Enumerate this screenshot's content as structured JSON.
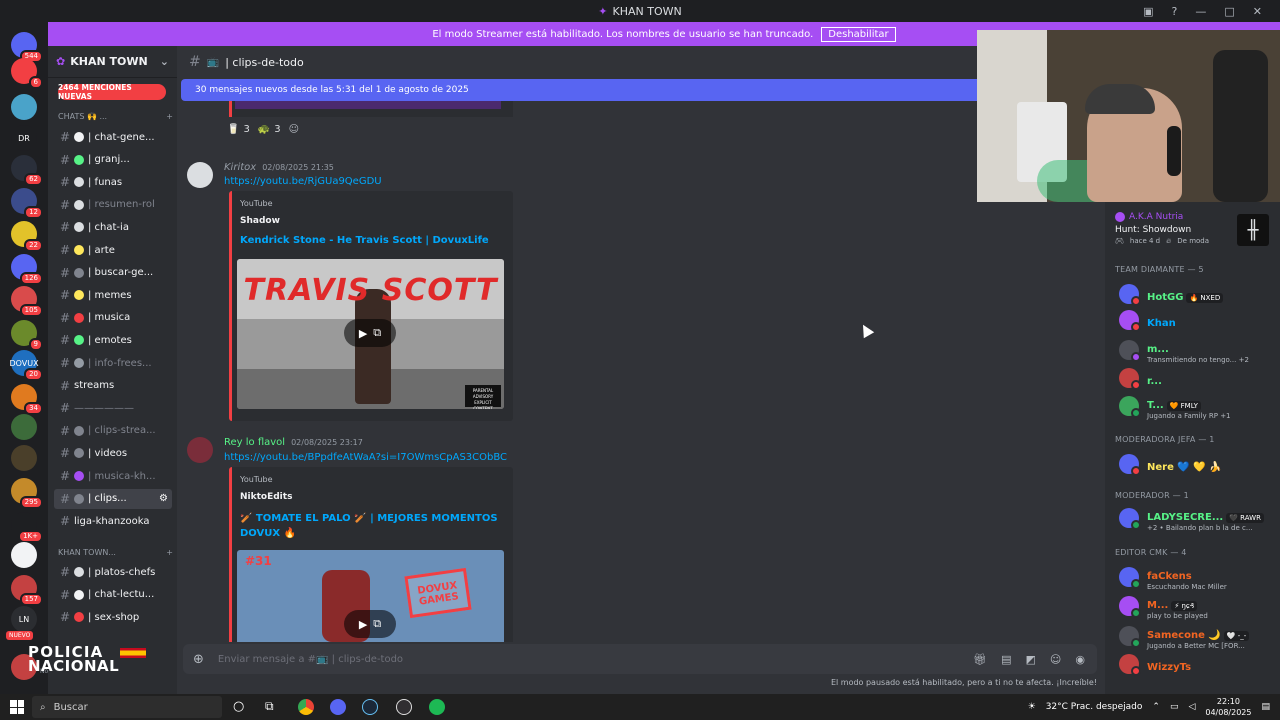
{
  "app": {
    "title": "KHAN TOWN"
  },
  "streamer_banner": {
    "text": "El modo Streamer está habilitado. Los nombres de usuario se han truncado.",
    "button": "Deshabilitar"
  },
  "servers": [
    {
      "label": "",
      "badge": "544",
      "color": "#5865f2"
    },
    {
      "label": "",
      "badge": "6",
      "color": "#f23f43"
    },
    {
      "label": "",
      "badge": "",
      "color": "#4aa3c9"
    },
    {
      "label": "DR",
      "badge": "",
      "color": "#1e1f22"
    },
    {
      "label": "",
      "badge": "62",
      "color": "#2a2f3a"
    },
    {
      "label": "",
      "badge": "12",
      "color": "#3b4c8c"
    },
    {
      "label": "",
      "badge": "22",
      "color": "#e2c22a"
    },
    {
      "label": "",
      "badge": "126",
      "color": "#5865f2"
    },
    {
      "label": "",
      "badge": "105",
      "color": "#d94b4b"
    },
    {
      "label": "",
      "badge": "9",
      "color": "#6b8a2b"
    },
    {
      "label": "DOVUX",
      "badge": "20",
      "color": "#1f6fbf"
    },
    {
      "label": "",
      "badge": "34",
      "color": "#e07a1f"
    },
    {
      "label": "",
      "badge": "",
      "color": "#3c6b3a"
    },
    {
      "label": "",
      "badge": "",
      "color": "#4a3f2a"
    },
    {
      "label": "",
      "badge": "295",
      "color": "#c48a2a"
    },
    {
      "label": "",
      "badge": "1K+",
      "color": "#1e1f22"
    },
    {
      "label": "",
      "badge": "",
      "color": "#f2f3f5"
    },
    {
      "label": "",
      "badge": "157",
      "color": "#c44141"
    },
    {
      "label": "LN",
      "badge": "",
      "color": "#2b2d31"
    }
  ],
  "server_new_label": "NUEVO",
  "guild": {
    "name": "KHAN TOWN",
    "mentions_pill": "2464 MENCIONES NUEVAS",
    "category_chats": "CHATS 🙌 ...",
    "category_khantown": "KHAN TOWN...",
    "channels": [
      {
        "name": "| chat-gene...",
        "muted": false,
        "emoji_color": "#f2f3f5"
      },
      {
        "name": "| granj...",
        "muted": false,
        "emoji_color": "#57f287"
      },
      {
        "name": "| funas",
        "muted": false,
        "emoji_color": "#dbdee1"
      },
      {
        "name": "| resumen-rol",
        "muted": true,
        "emoji_color": "#dbdee1"
      },
      {
        "name": "| chat-ia",
        "muted": false,
        "emoji_color": "#dbdee1"
      },
      {
        "name": "| arte",
        "muted": false,
        "emoji_color": "#fee75c"
      },
      {
        "name": "| buscar-ge...",
        "muted": false,
        "emoji_color": "#80848e"
      },
      {
        "name": "| memes",
        "muted": false,
        "emoji_color": "#fee75c"
      },
      {
        "name": "| musica",
        "muted": false,
        "emoji_color": "#f23f43"
      },
      {
        "name": "| emotes",
        "muted": false,
        "emoji_color": "#57f287"
      },
      {
        "name": "| info-frees...",
        "muted": true,
        "emoji_color": "#949ba4"
      },
      {
        "name": "streams",
        "muted": false,
        "emoji_color": ""
      },
      {
        "name": "——————",
        "muted": true,
        "emoji_color": ""
      },
      {
        "name": "| clips-strea...",
        "muted": true,
        "emoji_color": "#80848e"
      },
      {
        "name": "| videos",
        "muted": false,
        "emoji_color": "#80848e"
      },
      {
        "name": "| musica-kh...",
        "muted": true,
        "emoji_color": "#a64ef3"
      },
      {
        "name": "| clips...",
        "muted": false,
        "emoji_color": "#80848e",
        "selected": true
      },
      {
        "name": "liga-khanzooka",
        "muted": false,
        "emoji_color": ""
      }
    ],
    "channels2": [
      {
        "name": "| platos-chefs",
        "emoji_color": "#dbdee1"
      },
      {
        "name": "| chat-lectu...",
        "emoji_color": "#f2f3f5"
      },
      {
        "name": "| sex-shop",
        "emoji_color": "#f23f43"
      }
    ],
    "user_status": "No molestar"
  },
  "main": {
    "channel_name": "| clips-de-todo",
    "new_messages_bar": "30 mensajes nuevos desde las 5:31 del 1 de agosto de 2025",
    "reactions": [
      {
        "emoji": "🥛",
        "count": "3"
      },
      {
        "emoji": "🐢",
        "count": "3"
      }
    ],
    "messages": [
      {
        "author": "Kiritox",
        "author_color": "#949ba4",
        "time": "02/08/2025 21:35",
        "link": "https://youtu.be/RjGUa9QeGDU",
        "embed": {
          "provider": "YouTube",
          "author": "Shadow",
          "title": "Kendrick Stone - He Travis Scott | DovuxLife",
          "thumb_text": "TRAVIS SCOTT",
          "thumb_sub": "PARENTAL ADVISORY EXPLICIT CONTENT"
        }
      },
      {
        "author": "Rey lo flavol",
        "author_color": "#57f287",
        "time": "02/08/2025 23:17",
        "link": "https://youtu.be/BPpdfeAtWaA?si=I7OWmsCpAS3CObBC",
        "embed": {
          "provider": "YouTube",
          "author": "NiktoEdits",
          "title": "🏏 TOMATE EL PALO 🏏 | MEJORES MOMENTOS DOVUX 🔥",
          "thumb_text": "DOVUX GAMES",
          "thumb_sub": "#31"
        }
      }
    ],
    "composer_placeholder": "Enviar mensaje a #📺 | clips-de-todo",
    "paused_notice": "El modo pausado está habilitado, pero a ti no te afecta. ¡Increíble!"
  },
  "members": {
    "activity": {
      "name": "A.K.A Nutria",
      "game": "Hunt: Showdown",
      "meta": "hace 4 d",
      "meta2": "De moda"
    },
    "sections": [
      {
        "title": "TEAM DIAMANTE — 5",
        "members": [
          {
            "name": "HotGG",
            "tag": "🔥 NXED",
            "status": "",
            "color": "#57f287",
            "dot": "#f23f43"
          },
          {
            "name": "Khan",
            "tag": "",
            "status": "",
            "color": "#00a8fc",
            "dot": "#f23f43"
          },
          {
            "name": "m...",
            "tag": "",
            "status": "Transmitiendo no tengo... +2",
            "color": "#57f287",
            "dot": "#a64ef3"
          },
          {
            "name": "r...",
            "tag": "",
            "status": "",
            "color": "#57f287",
            "dot": "#f23f43"
          },
          {
            "name": "T...",
            "tag": "🧡 FMLY",
            "status": "Jugando a Family RP +1",
            "color": "#57f287",
            "dot": "#23a55a"
          }
        ]
      },
      {
        "title": "MODERADORA JEFA — 1",
        "members": [
          {
            "name": "Nere 💙 💛 🍌",
            "tag": "",
            "status": "",
            "color": "#fee75c",
            "dot": "#f23f43"
          }
        ]
      },
      {
        "title": "MODERADOR — 1",
        "members": [
          {
            "name": "LADYSECRE...",
            "tag": "🖤 RAWR",
            "status": "+2 • Bailando plan b la de c...",
            "color": "#57f287",
            "dot": "#23a55a"
          }
        ]
      },
      {
        "title": "EDITOR CMK — 4",
        "members": [
          {
            "name": "faCkens",
            "tag": "",
            "status": "Escuchando Mac Miller",
            "color": "#f26522",
            "dot": "#23a55a"
          },
          {
            "name": "M...",
            "tag": "⚡ ŋɕ₰",
            "status": "play to be played",
            "color": "#f26522",
            "dot": "#23a55a"
          },
          {
            "name": "Samecone 🌙",
            "tag": "🤍 -_-",
            "status": "Jugando a Better MC [FOR...",
            "color": "#f26522",
            "dot": "#23a55a"
          },
          {
            "name": "WizzyTs",
            "tag": "",
            "status": "",
            "color": "#f26522",
            "dot": "#f23f43"
          }
        ]
      }
    ]
  },
  "overlay": {
    "line1": "POLICIA",
    "line2": "NACIONAL"
  },
  "taskbar": {
    "search": "Buscar",
    "weather": "32°C  Prac. despejado",
    "time": "22:10",
    "date": "04/08/2025"
  }
}
